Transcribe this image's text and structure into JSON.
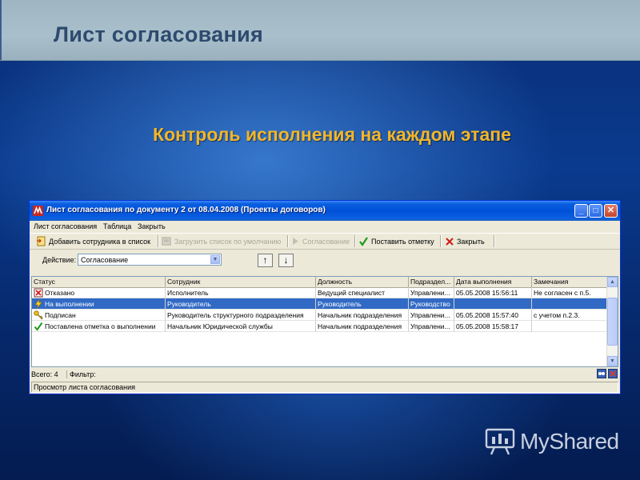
{
  "slide": {
    "title": "Лист согласования",
    "subtitle": "Контроль исполнения на каждом этапе"
  },
  "window": {
    "title": "Лист согласования по документу 2 от 08.04.2008 (Проекты договоров)",
    "controls": {
      "minimize": "_",
      "maximize": "□",
      "close": "✕"
    },
    "menu": [
      "Лист согласования",
      "Таблица",
      "Закрыть"
    ],
    "toolbar": {
      "add": "Добавить сотрудника в список",
      "load_default": "Загрузить список по умолчанию",
      "approval": "Согласование",
      "set_mark": "Поставить отметку",
      "close": "Закрыть"
    },
    "action": {
      "label": "Действие:",
      "value": "Согласование"
    },
    "grid": {
      "columns": [
        "Статус",
        "Сотрудник",
        "Должность",
        "Подраздел...",
        "Дата выполнения",
        "Замечания"
      ],
      "rows": [
        {
          "status": "Отказано",
          "icon": "rejected-icon",
          "employee": "Исполнитель",
          "position": "Ведущий специалист",
          "dept": "Управлени...",
          "date": "05.05.2008 15:56:11",
          "notes": "Не согласен с п.5."
        },
        {
          "status": "На выполнении",
          "icon": "in-progress-icon",
          "employee": "Руководитель",
          "position": "Руководитель",
          "dept": "Руководство",
          "date": "",
          "notes": ""
        },
        {
          "status": "Подписан",
          "icon": "key-icon",
          "employee": "Руководитель структурного подразделения",
          "position": "Начальник подразделения",
          "dept": "Управлени...",
          "date": "05.05.2008 15:57:40",
          "notes": "с учетом п.2.3."
        },
        {
          "status": "Поставлена отметка о выполнении",
          "icon": "checkmark-icon",
          "employee": "Начальник Юридической службы",
          "position": "Начальник подразделения",
          "dept": "Управлени...",
          "date": "05.05.2008 15:58:17",
          "notes": ""
        }
      ],
      "selected_row": 1
    },
    "status": {
      "total": "Всего: 4",
      "filter": "Фильтр:",
      "bottom": "Просмотр листа согласования"
    }
  },
  "brand": {
    "name": "MyShared"
  },
  "colors": {
    "subtitle": "#f2b62a",
    "title": "#2e4a6e",
    "selection": "#316ac5",
    "titlebar": "#0150d8"
  }
}
